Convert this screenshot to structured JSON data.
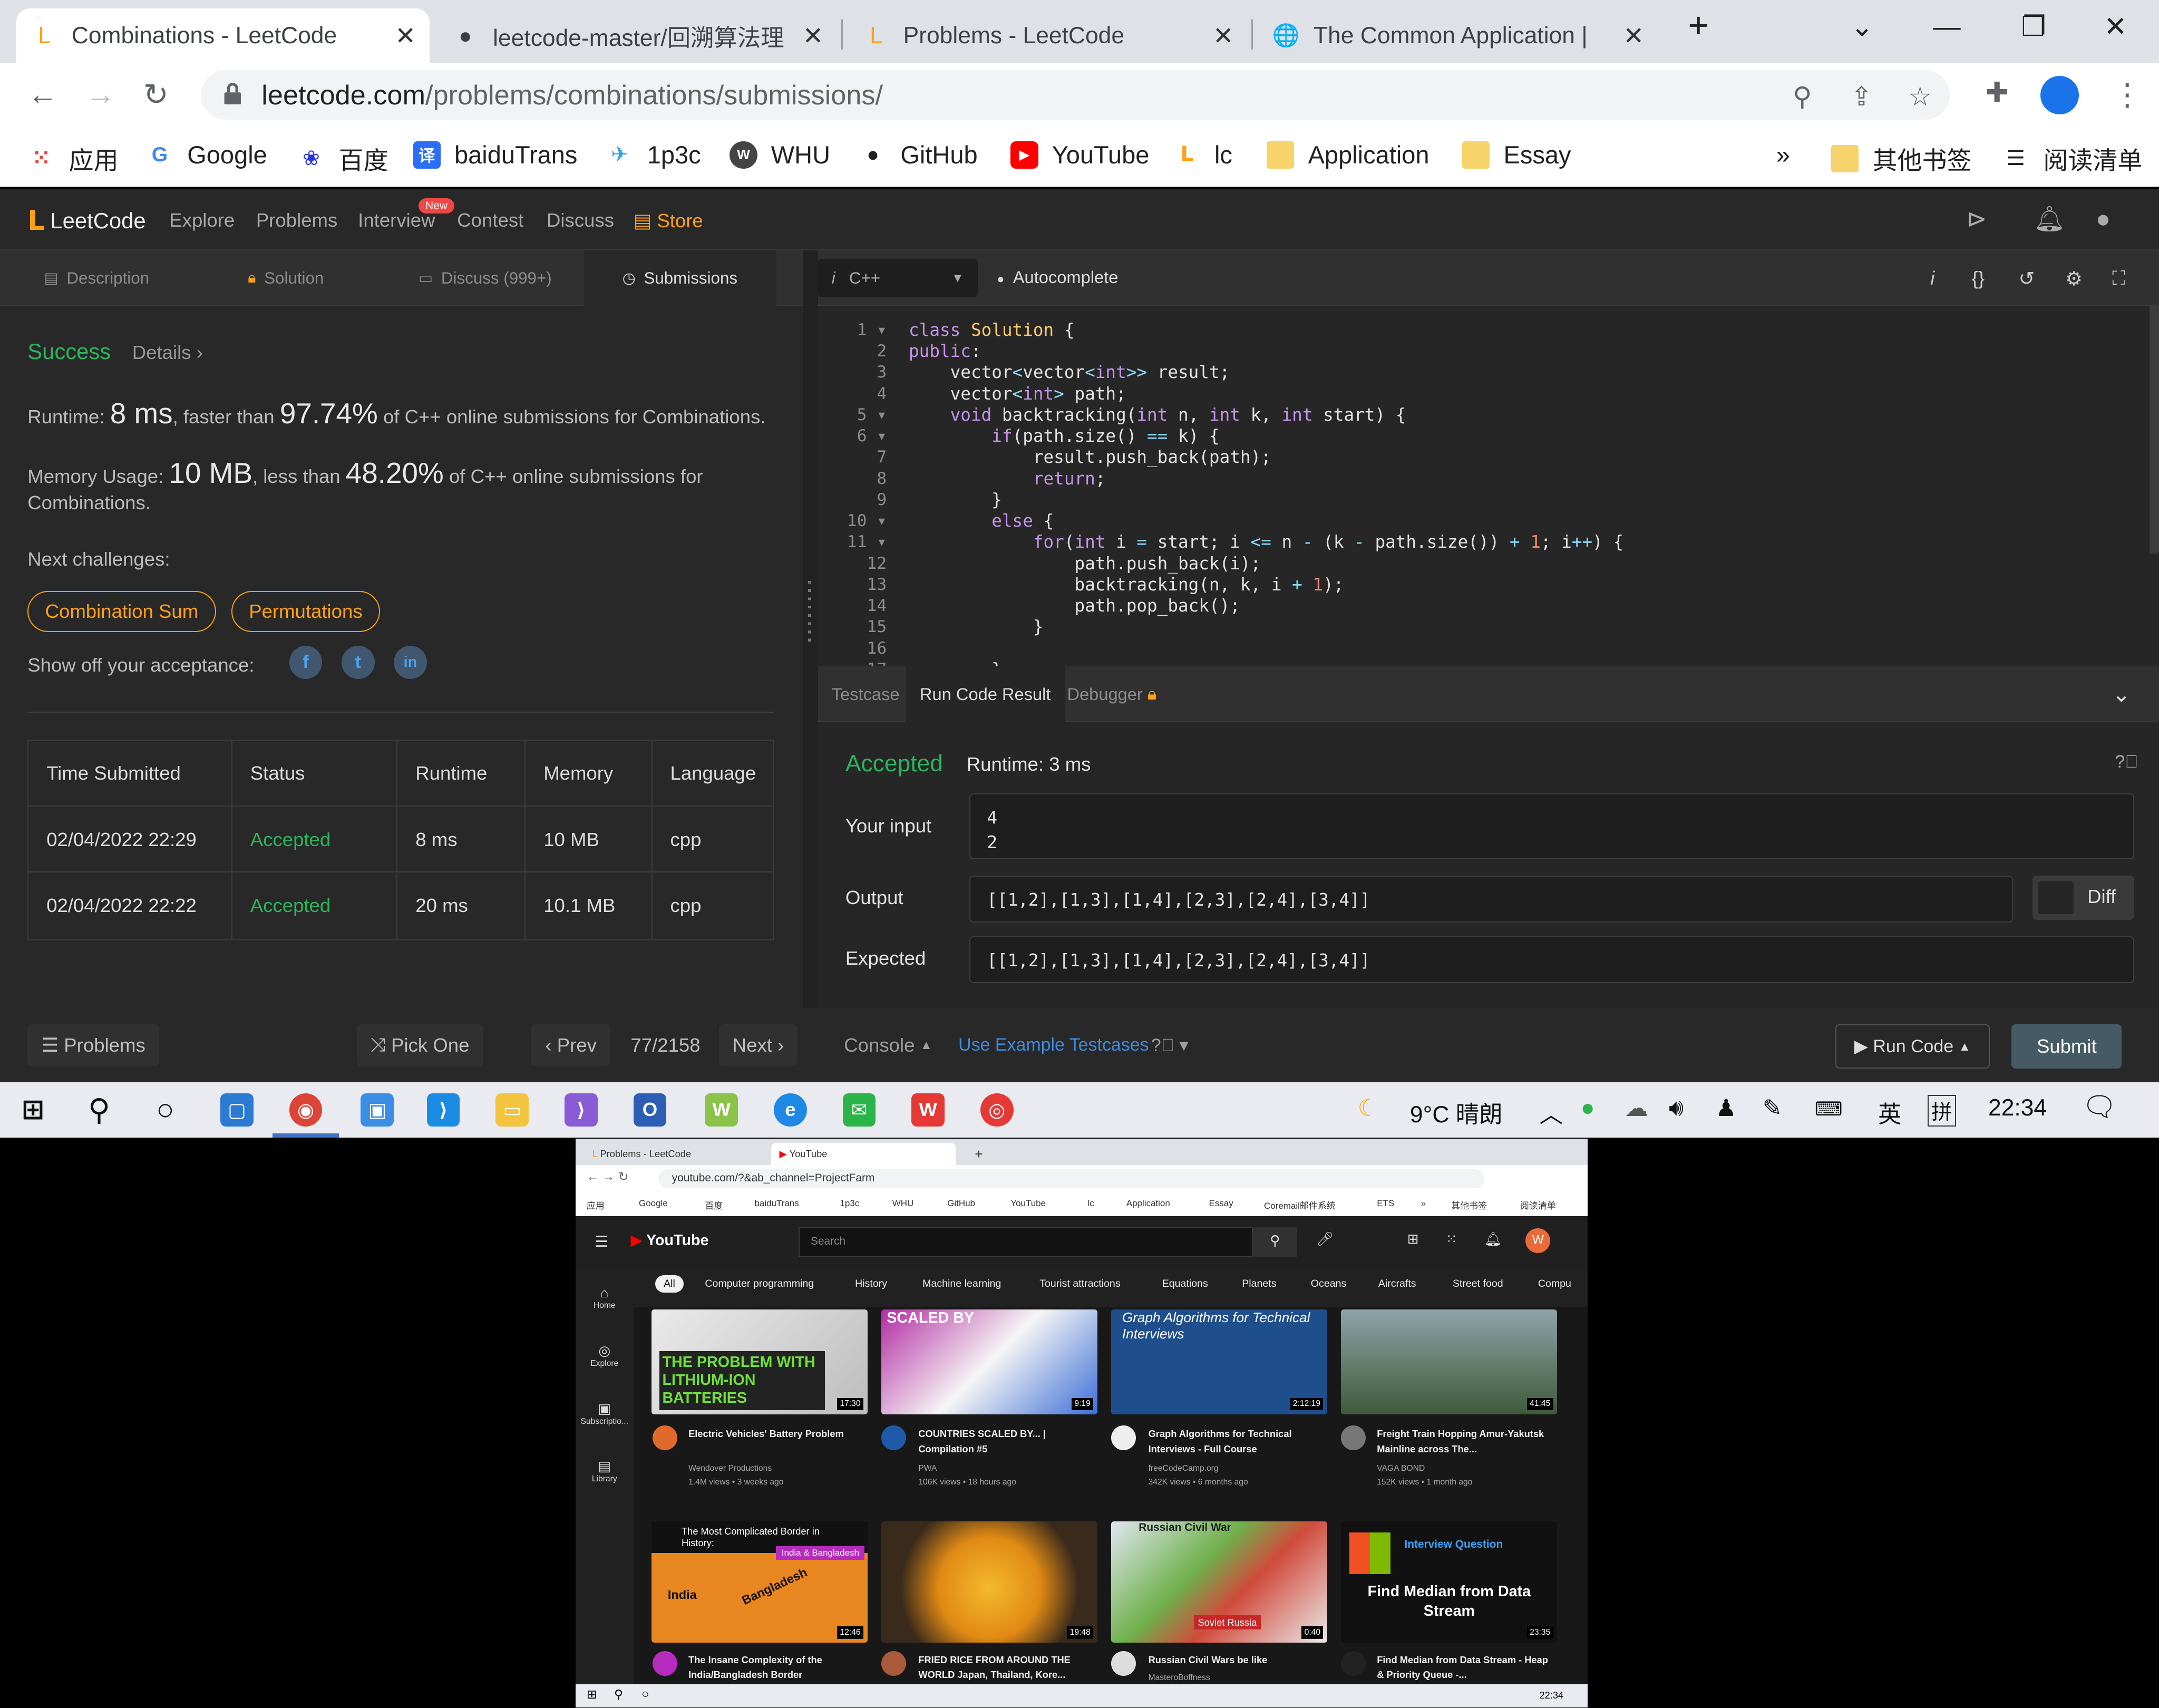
{
  "browser": {
    "tabs": [
      {
        "title": "Combinations - LeetCode",
        "icon": "leetcode-icon"
      },
      {
        "title": "leetcode-master/回溯算法理",
        "icon": "github-icon"
      },
      {
        "title": "Problems - LeetCode",
        "icon": "leetcode-icon"
      },
      {
        "title": "The Common Application |",
        "icon": "globe-icon"
      }
    ],
    "url_domain": "leetcode.com",
    "url_path": "/problems/combinations/submissions/",
    "bookmarks": [
      "应用",
      "Google",
      "百度",
      "baiduTrans",
      "1p3c",
      "WHU",
      "GitHub",
      "YouTube",
      "lc",
      "Application",
      "Essay",
      "其他书签",
      "阅读清单"
    ],
    "bookmarks_more": "»"
  },
  "lc": {
    "logo": "LeetCode",
    "nav": [
      "Explore",
      "Problems",
      "Interview",
      "Contest",
      "Discuss",
      "Store"
    ],
    "new_badge": "New",
    "left_tabs": [
      "Description",
      "Solution",
      "Discuss (999+)",
      "Submissions"
    ],
    "success": "Success",
    "details": "Details",
    "runtime_label": "Runtime: ",
    "runtime_value": "8 ms",
    "runtime_mid": ", faster than ",
    "runtime_pct": "97.74%",
    "runtime_tail": " of C++ online submissions for Combinations.",
    "mem_label": "Memory Usage: ",
    "mem_value": "10 MB",
    "mem_mid": ", less than ",
    "mem_pct": "48.20%",
    "mem_tail": " of C++ online submissions for",
    "mem_tail2": "Combinations.",
    "next_label": "Next challenges:",
    "challenges": [
      "Combination Sum",
      "Permutations"
    ],
    "show_off": "Show off your acceptance:",
    "table": {
      "headers": [
        "Time Submitted",
        "Status",
        "Runtime",
        "Memory",
        "Language"
      ],
      "rows": [
        [
          "02/04/2022 22:29",
          "Accepted",
          "8 ms",
          "10 MB",
          "cpp"
        ],
        [
          "02/04/2022 22:22",
          "Accepted",
          "20 ms",
          "10.1 MB",
          "cpp"
        ]
      ]
    },
    "lang": "C++",
    "autocomplete": "Autocomplete",
    "console_tabs": [
      "Testcase",
      "Run Code Result",
      "Debugger"
    ],
    "result_status": "Accepted",
    "result_runtime": "Runtime: 3 ms",
    "input_label": "Your input",
    "input_value": "4\n2",
    "output_label": "Output",
    "output_value": "[[1,2],[1,3],[1,4],[2,3],[2,4],[3,4]]",
    "expected_label": "Expected",
    "expected_value": "[[1,2],[1,3],[1,4],[2,3],[2,4],[3,4]]",
    "diff": "Diff",
    "bottom": {
      "problems": "Problems",
      "pick": "Pick One",
      "prev": "Prev",
      "page": "77/2158",
      "next": "Next",
      "console": "Console",
      "example": "Use Example Testcases",
      "run": "Run Code",
      "submit": "Submit"
    }
  },
  "code_lines": [
    "1",
    "2",
    "3",
    "4",
    "5",
    "6",
    "7",
    "8",
    "9",
    "10",
    "11",
    "12",
    "13",
    "14",
    "15",
    "16",
    "17"
  ],
  "taskbar": {
    "weather": "9°C 晴朗",
    "ime": "英",
    "ime2": "拼",
    "time": "22:34"
  },
  "yt": {
    "tabs": [
      "Problems - LeetCode",
      "YouTube"
    ],
    "url": "youtube.com/?&ab_channel=ProjectFarm",
    "bookmarks": [
      "应用",
      "Google",
      "百度",
      "baiduTrans",
      "1p3c",
      "WHU",
      "GitHub",
      "YouTube",
      "lc",
      "Application",
      "Essay",
      "Coremail邮件系统",
      "ETS",
      "»",
      "其他书签",
      "阅读清单"
    ],
    "logo": "YouTube",
    "search": "Search",
    "avatar": "W",
    "chips": [
      "All",
      "Computer programming",
      "History",
      "Machine learning",
      "Tourist attractions",
      "Equations",
      "Planets",
      "Oceans",
      "Aircrafts",
      "Street food",
      "Compu"
    ],
    "side": [
      "Home",
      "Explore",
      "Subscriptio...",
      "Library"
    ],
    "videos": [
      {
        "title": "Electric Vehicles' Battery Problem",
        "channel": "Wendover Productions",
        "meta": "1.4M views • 3 weeks ago",
        "dur": "17:30",
        "thumb": "THE PROBLEM WITH LITHIUM-ION BATTERIES"
      },
      {
        "title": "COUNTRIES SCALED BY... | Compilation #5",
        "channel": "PWA",
        "meta": "106K views • 18 hours ago",
        "dur": "9:19",
        "thumb": "SCALED BY"
      },
      {
        "title": "Graph Algorithms for Technical Interviews - Full Course",
        "channel": "freeCodeCamp.org",
        "meta": "342K views • 6 months ago",
        "dur": "2:12:19",
        "thumb": "Graph Algorithms for Technical Interviews"
      },
      {
        "title": "Freight Train Hopping Amur-Yakutsk Mainline across The...",
        "channel": "VAGA BOND",
        "meta": "152K views • 1 month ago",
        "dur": "41:45",
        "thumb": ""
      },
      {
        "title": "The Insane Complexity of the India/Bangladesh Border",
        "channel": "",
        "meta": "",
        "dur": "12:46",
        "thumb": "The Most Complicated Border in History:"
      },
      {
        "title": "FRIED RICE FROM AROUND THE WORLD Japan, Thailand, Kore...",
        "channel": "",
        "meta": "",
        "dur": "19:48",
        "thumb": ""
      },
      {
        "title": "Russian Civil Wars be like",
        "channel": "MasteroBoffness",
        "meta": "",
        "dur": "0:40",
        "thumb": "Russian Civil War"
      },
      {
        "title": "Find Median from Data Stream - Heap & Priority Queue -...",
        "channel": "",
        "meta": "",
        "dur": "23:35",
        "thumb": "Find Median from Data Stream"
      }
    ],
    "thumb_extra": {
      "india": "India",
      "bangladesh": "Bangladesh",
      "india_bd": "India & Bangladesh",
      "soviet": "Soviet Russia",
      "interview": "Interview Question"
    },
    "time": "22:34"
  }
}
